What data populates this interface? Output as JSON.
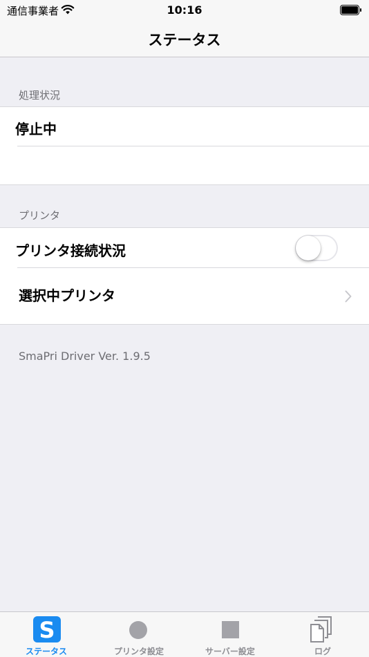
{
  "status_bar": {
    "carrier": "通信事業者",
    "time": "10:16"
  },
  "nav": {
    "title": "ステータス"
  },
  "processing_section": {
    "header": "処理状況",
    "status_text": "停止中",
    "detail_text": ""
  },
  "printer_section": {
    "header": "プリンタ",
    "connection_label": "プリンタ接続状況",
    "connection_on": false,
    "selected_label": "選択中プリンタ"
  },
  "version_text": "SmaPri Driver Ver. 1.9.5",
  "tabs": [
    {
      "label": "ステータス",
      "icon": "s-app-icon",
      "active": true
    },
    {
      "label": "プリンタ設定",
      "icon": "circle-icon",
      "active": false
    },
    {
      "label": "サーバー設定",
      "icon": "square-icon",
      "active": false
    },
    {
      "label": "ログ",
      "icon": "documents-icon",
      "active": false
    }
  ],
  "colors": {
    "accent": "#1a8bf0",
    "background": "#efeff4",
    "inactive_tab": "#8e8e93"
  }
}
